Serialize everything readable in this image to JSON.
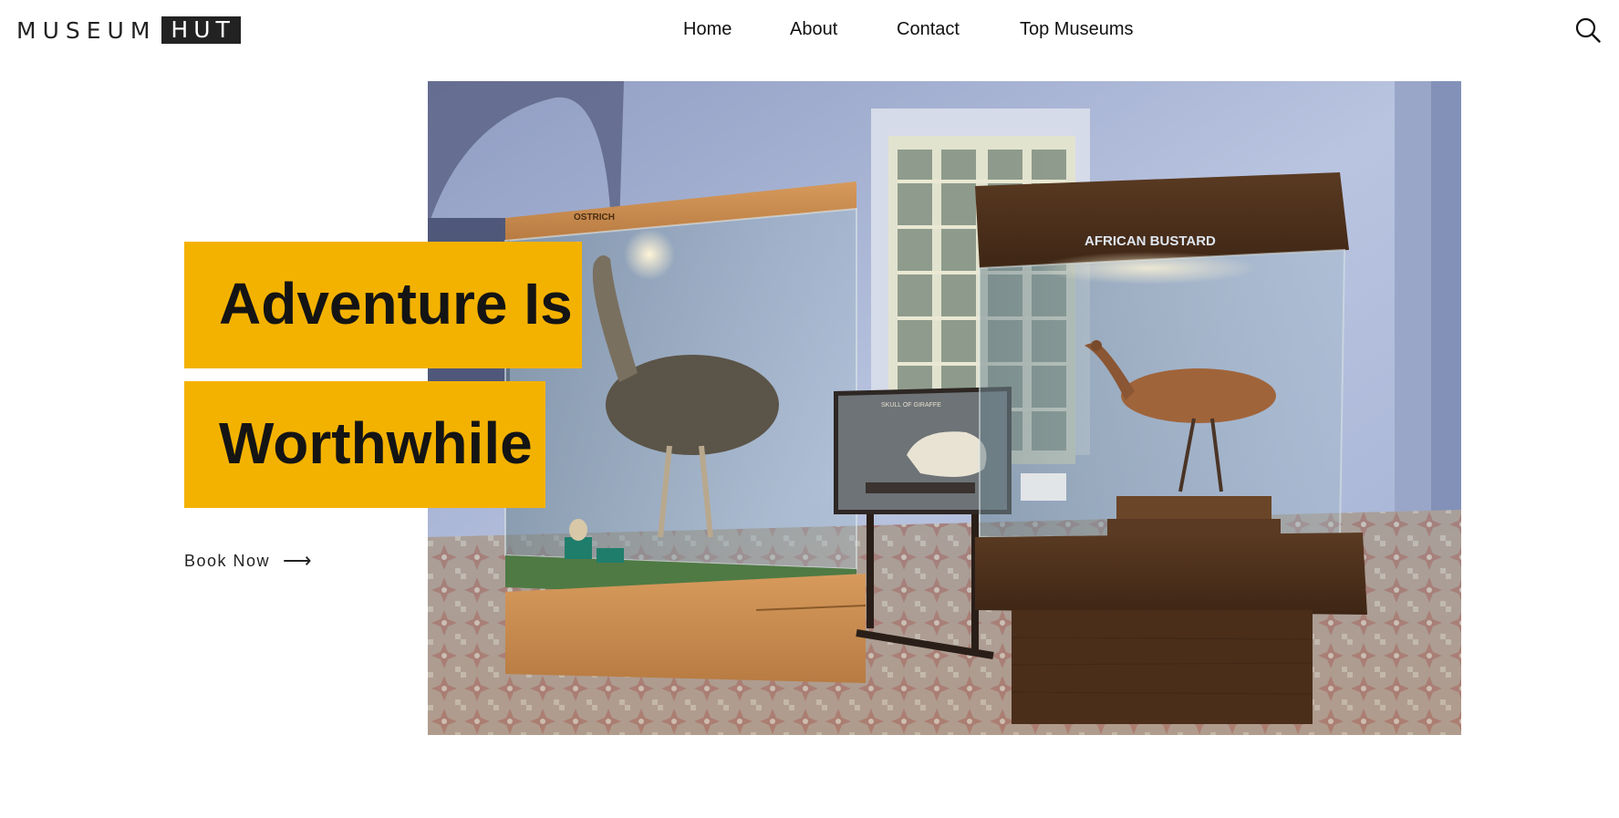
{
  "header": {
    "logo_word": "MUSEUM",
    "logo_box": "HUT",
    "nav": [
      {
        "label": "Home"
      },
      {
        "label": "About"
      },
      {
        "label": "Contact"
      },
      {
        "label": "Top Museums"
      }
    ],
    "search_icon": "search-icon"
  },
  "hero": {
    "headline_line1": "Adventure Is",
    "headline_line2": "Worthwhile",
    "cta_label": "Book Now",
    "cta_arrow": "⟶",
    "photo": {
      "left_case_label": "OSTRICH",
      "small_case_label": "SKULL OF GIRAFFE",
      "right_case_label": "AFRICAN BUSTARD"
    }
  },
  "colors": {
    "accent": "#f4b200",
    "nav_highlight": "#f2c758",
    "text": "#111111"
  }
}
